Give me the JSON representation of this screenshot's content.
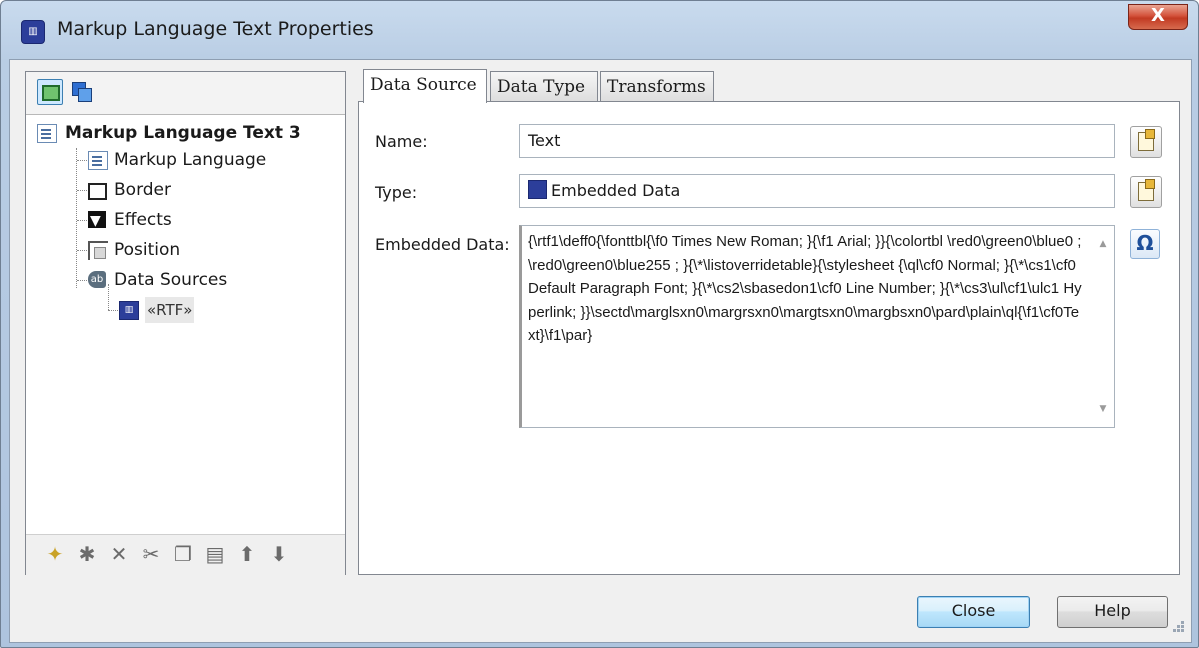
{
  "window": {
    "title": "Markup Language Text Properties",
    "close_glyph": "X"
  },
  "left_toolbar": {
    "buttons": [
      {
        "icon": "object-view-icon"
      },
      {
        "icon": "layers-icon"
      }
    ]
  },
  "tree": {
    "root": "Markup Language Text 3",
    "children": [
      {
        "label": "Markup Language",
        "icon": "markup-icon"
      },
      {
        "label": "Border",
        "icon": "border-icon"
      },
      {
        "label": "Effects",
        "icon": "effects-icon"
      },
      {
        "label": "Position",
        "icon": "position-icon"
      },
      {
        "label": "Data Sources",
        "icon": "data-sources-icon"
      }
    ],
    "data_source_child": "«RTF»"
  },
  "left_bottom_toolbar": [
    {
      "icon": "new-icon",
      "glyph": "✦"
    },
    {
      "icon": "wizard-icon",
      "glyph": "✱"
    },
    {
      "icon": "delete-icon",
      "glyph": "✕"
    },
    {
      "icon": "cut-icon",
      "glyph": "✂"
    },
    {
      "icon": "copy-icon",
      "glyph": "❐"
    },
    {
      "icon": "paste-icon",
      "glyph": "▤"
    },
    {
      "icon": "move-up-icon",
      "glyph": "⬆"
    },
    {
      "icon": "move-down-icon",
      "glyph": "⬇"
    }
  ],
  "tabs": [
    {
      "label": "Data Source",
      "active": true
    },
    {
      "label": "Data Type",
      "active": false
    },
    {
      "label": "Transforms",
      "active": false
    }
  ],
  "form": {
    "name_label": "Name:",
    "name_value": "Text",
    "type_label": "Type:",
    "type_value": "Embedded Data",
    "embedded_label": "Embedded Data:",
    "embedded_value": "{\\rtf1\\deff0{\\fonttbl{\\f0 Times New Roman; }{\\f1 Arial; }}{\\colortbl \\red0\\green0\\blue0 ; \\red0\\green0\\blue255 ; }{\\*\\listoverridetable}{\\stylesheet {\\ql\\cf0 Normal; }{\\*\\cs1\\cf0 Default Paragraph Font; }{\\*\\cs2\\sbasedon1\\cf0 Line Number; }{\\*\\cs3\\ul\\cf1\\ulc1 Hyperlink; }}\\sectd\\marglsxn0\\margrsxn0\\margtsxn0\\margbsxn0\\pard\\plain\\ql{\\f1\\cf0Text}\\f1\\par}"
  },
  "footer": {
    "close_label": "Close",
    "help_label": "Help"
  }
}
